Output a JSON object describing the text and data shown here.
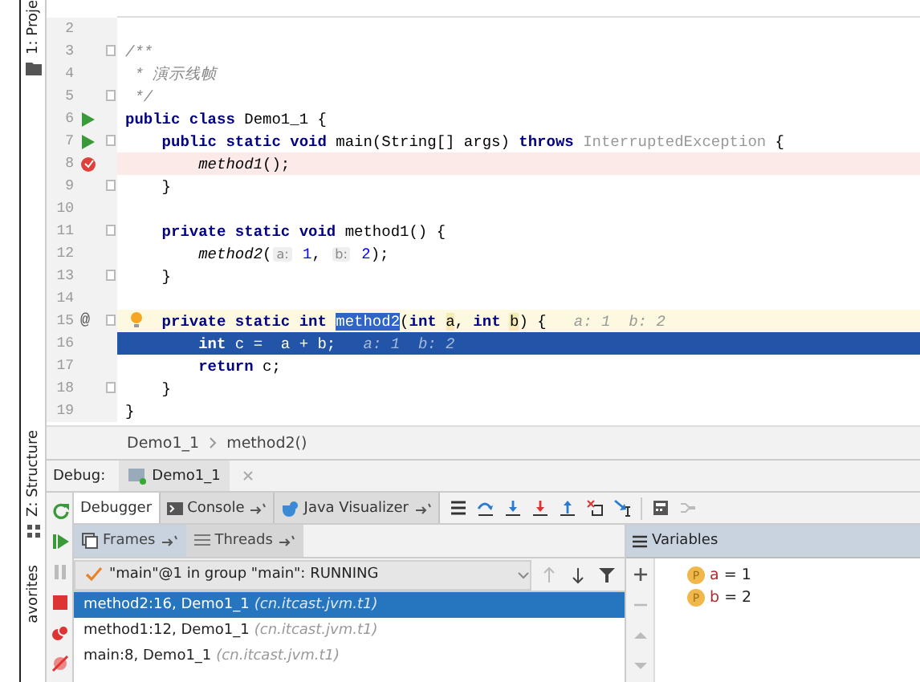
{
  "sidebar_tabs": [
    {
      "label": "1: Proje"
    },
    {
      "label": "Z: Structure"
    },
    {
      "label": "avorites"
    }
  ],
  "editor": {
    "lines": [
      {
        "number": "2",
        "kind": "plain",
        "runnable": false,
        "fold": false,
        "bulb": false
      },
      {
        "number": "3",
        "kind": "plain",
        "runnable": false,
        "fold": true,
        "bulb": false,
        "tokens": [
          {
            "text": "/**",
            "kind": "comment"
          }
        ]
      },
      {
        "number": "4",
        "kind": "plain",
        "runnable": false,
        "fold": false,
        "bulb": false,
        "tokens": [
          {
            "text": " * 演示线帧",
            "kind": "comment"
          }
        ]
      },
      {
        "number": "5",
        "kind": "plain",
        "runnable": false,
        "fold": true,
        "bulb": false,
        "tokens": [
          {
            "text": " */",
            "kind": "comment"
          }
        ]
      },
      {
        "number": "6",
        "kind": "plain",
        "runnable": true,
        "fold": false,
        "bulb": false,
        "tokens": [
          {
            "text": "public class",
            "kind": "kw"
          },
          {
            "text": " Demo1_1 {",
            "kind": "plain"
          }
        ]
      },
      {
        "number": "7",
        "kind": "plain",
        "runnable": true,
        "fold": true,
        "bulb": false,
        "tokens": [
          {
            "text": "    public static void",
            "kind": "kw"
          },
          {
            "text": " main(String[] args) ",
            "kind": "plain"
          },
          {
            "text": "throws",
            "kind": "kw"
          },
          {
            "text": " InterruptedException",
            "kind": "gray"
          },
          {
            "text": " {",
            "kind": "plain"
          }
        ]
      },
      {
        "number": "8",
        "kind": "breakpoint",
        "runnable": false,
        "fold": false,
        "bulb": false,
        "tokens": [
          {
            "text": "        method1",
            "kind": "call"
          },
          {
            "text": "();",
            "kind": "plain"
          }
        ]
      },
      {
        "number": "9",
        "kind": "plain",
        "runnable": false,
        "fold": true,
        "bulb": false,
        "tokens": [
          {
            "text": "    }",
            "kind": "plain"
          }
        ]
      },
      {
        "number": "10",
        "kind": "plain",
        "runnable": false,
        "fold": false,
        "bulb": false
      },
      {
        "number": "11",
        "kind": "plain",
        "runnable": false,
        "fold": true,
        "bulb": false,
        "tokens": [
          {
            "text": "    private static void",
            "kind": "kw"
          },
          {
            "text": " method1() {",
            "kind": "plain"
          }
        ]
      },
      {
        "number": "12",
        "kind": "plain",
        "runnable": false,
        "fold": false,
        "bulb": false,
        "tokens": [
          {
            "text": "        method2",
            "kind": "call"
          },
          {
            "text": "(",
            "kind": "plain"
          },
          {
            "text": "a:",
            "kind": "hint"
          },
          {
            "text": " 1",
            "kind": "num"
          },
          {
            "text": ", ",
            "kind": "plain"
          },
          {
            "text": "b:",
            "kind": "hint"
          },
          {
            "text": " 2",
            "kind": "num"
          },
          {
            "text": ");",
            "kind": "plain"
          }
        ]
      },
      {
        "number": "13",
        "kind": "plain",
        "runnable": false,
        "fold": true,
        "bulb": false,
        "tokens": [
          {
            "text": "    }",
            "kind": "plain"
          }
        ]
      },
      {
        "number": "14",
        "kind": "plain",
        "runnable": false,
        "fold": false,
        "bulb": false
      },
      {
        "number": "15",
        "kind": "caret",
        "runnable": false,
        "fold": true,
        "bulb": true,
        "gutter_text": "@",
        "tokens": [
          {
            "text": "    private static int ",
            "kind": "kw"
          },
          {
            "text": "method2",
            "kind": "sel"
          },
          {
            "text": "(",
            "kind": "plain"
          },
          {
            "text": "int ",
            "kind": "kw"
          },
          {
            "text": "a",
            "kind": "mark"
          },
          {
            "text": ", ",
            "kind": "plain"
          },
          {
            "text": "int ",
            "kind": "kw"
          },
          {
            "text": "b",
            "kind": "mark"
          },
          {
            "text": ") {",
            "kind": "plain"
          },
          {
            "text": "   a: 1  b: 2",
            "kind": "inline"
          }
        ]
      },
      {
        "number": "16",
        "kind": "current",
        "runnable": false,
        "fold": false,
        "bulb": false,
        "tokens": [
          {
            "text": "        int",
            "kind": "kw"
          },
          {
            "text": " c =  a + b;",
            "kind": "plain"
          },
          {
            "text": "   a: 1  b: 2",
            "kind": "inline"
          }
        ]
      },
      {
        "number": "17",
        "kind": "plain",
        "runnable": false,
        "fold": false,
        "bulb": false,
        "tokens": [
          {
            "text": "        return",
            "kind": "kw"
          },
          {
            "text": " c;",
            "kind": "plain"
          }
        ]
      },
      {
        "number": "18",
        "kind": "plain",
        "runnable": false,
        "fold": true,
        "bulb": false,
        "tokens": [
          {
            "text": "    }",
            "kind": "plain"
          }
        ]
      },
      {
        "number": "19",
        "kind": "plain",
        "runnable": false,
        "fold": false,
        "bulb": false,
        "tokens": [
          {
            "text": "}",
            "kind": "plain"
          }
        ]
      }
    ]
  },
  "breadcrumb": [
    "Demo1_1",
    "method2()"
  ],
  "debug": {
    "label": "Debug:",
    "session_tab": "Demo1_1",
    "tabs": [
      {
        "label": "Debugger",
        "selected": true
      },
      {
        "label": "Console",
        "selected": false
      },
      {
        "label": "Java Visualizer",
        "selected": false
      }
    ],
    "frame_tabs": [
      {
        "label": "Frames",
        "selected": true
      },
      {
        "label": "Threads",
        "selected": false
      }
    ],
    "thread": "\"main\"@1 in group \"main\": RUNNING",
    "frames": [
      {
        "location": "method2:16, Demo1_1",
        "package": "(cn.itcast.jvm.t1)",
        "selected": true
      },
      {
        "location": "method1:12, Demo1_1",
        "package": "(cn.itcast.jvm.t1)",
        "selected": false
      },
      {
        "location": "main:8, Demo1_1",
        "package": "(cn.itcast.jvm.t1)",
        "selected": false
      }
    ],
    "variables_title": "Variables",
    "variables": [
      {
        "badge": "P",
        "name": "a",
        "value": "= 1"
      },
      {
        "badge": "P",
        "name": "b",
        "value": "= 2"
      }
    ]
  }
}
